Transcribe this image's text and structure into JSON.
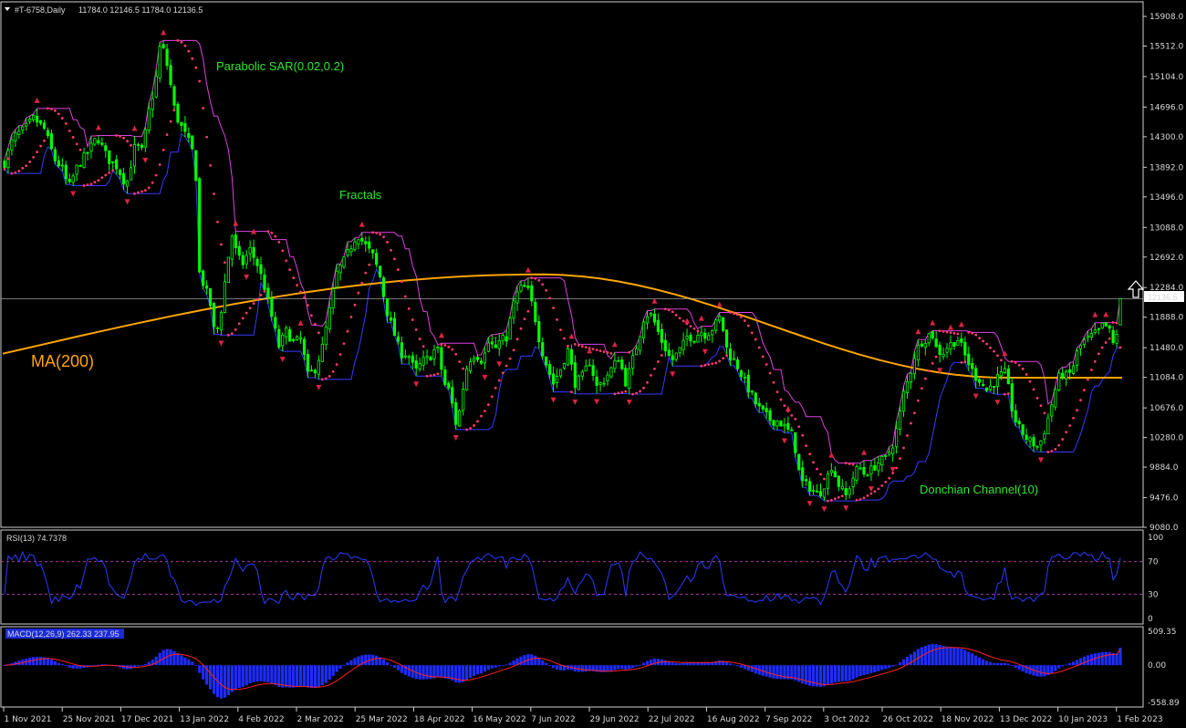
{
  "chart_data": {
    "type": "candlestick",
    "header": {
      "title": "#T-6758,Daily",
      "ohlc": "11784.0 12146.5 11784.0 12136.5"
    },
    "price_axis": {
      "ticks": [
        "15908.0",
        "15512.0",
        "15104.0",
        "14696.0",
        "14300.0",
        "13892.0",
        "13496.0",
        "13088.0",
        "12692.0",
        "12284.0",
        "11888.0",
        "11480.0",
        "11084.0",
        "10676.0",
        "10280.0",
        "9884.0",
        "9476.0",
        "9080.0"
      ],
      "ylim": [
        9080,
        15908
      ],
      "current_price": "12136.5"
    },
    "x_axis": {
      "ticks": [
        "1 Nov 2021",
        "25 Nov 2021",
        "17 Dec 2021",
        "13 Jan 2022",
        "4 Feb 2022",
        "2 Mar 2022",
        "25 Mar 2022",
        "18 Apr 2022",
        "16 May 2022",
        "7 Jun 2022",
        "29 Jun 2022",
        "22 Jul 2022",
        "16 Aug 2022",
        "7 Sep 2022",
        "3 Oct 2022",
        "26 Oct 2022",
        "18 Nov 2022",
        "13 Dec 2022",
        "10 Jan 2023",
        "1 Feb 2023"
      ]
    },
    "close_path": [
      [
        0,
        13950
      ],
      [
        10,
        14300
      ],
      [
        22,
        14400
      ],
      [
        32,
        14550
      ],
      [
        44,
        14400
      ],
      [
        55,
        14000
      ],
      [
        65,
        13850
      ],
      [
        70,
        13600
      ],
      [
        80,
        13900
      ],
      [
        92,
        14100
      ],
      [
        102,
        14300
      ],
      [
        114,
        14000
      ],
      [
        124,
        13900
      ],
      [
        134,
        13650
      ],
      [
        144,
        14200
      ],
      [
        152,
        14100
      ],
      [
        158,
        14600
      ],
      [
        166,
        15000
      ],
      [
        172,
        15600
      ],
      [
        180,
        15200
      ],
      [
        188,
        14600
      ],
      [
        196,
        14400
      ],
      [
        204,
        14200
      ],
      [
        210,
        14000
      ],
      [
        214,
        12500
      ],
      [
        220,
        12300
      ],
      [
        226,
        12100
      ],
      [
        232,
        11600
      ],
      [
        238,
        11950
      ],
      [
        244,
        12500
      ],
      [
        250,
        13000
      ],
      [
        256,
        12700
      ],
      [
        262,
        12600
      ],
      [
        270,
        12800
      ],
      [
        278,
        12600
      ],
      [
        286,
        12300
      ],
      [
        294,
        11900
      ],
      [
        302,
        11500
      ],
      [
        310,
        11700
      ],
      [
        318,
        11550
      ],
      [
        326,
        11600
      ],
      [
        334,
        11100
      ],
      [
        342,
        11200
      ],
      [
        350,
        11500
      ],
      [
        358,
        12000
      ],
      [
        366,
        12500
      ],
      [
        372,
        12600
      ],
      [
        380,
        12800
      ],
      [
        388,
        13000
      ],
      [
        394,
        12900
      ],
      [
        400,
        12800
      ],
      [
        406,
        12700
      ],
      [
        414,
        12400
      ],
      [
        420,
        12000
      ],
      [
        428,
        11700
      ],
      [
        436,
        11400
      ],
      [
        444,
        11400
      ],
      [
        452,
        11150
      ],
      [
        460,
        11300
      ],
      [
        468,
        11350
      ],
      [
        476,
        11500
      ],
      [
        484,
        11000
      ],
      [
        490,
        10900
      ],
      [
        498,
        10400
      ],
      [
        504,
        10900
      ],
      [
        510,
        11300
      ],
      [
        518,
        11400
      ],
      [
        526,
        11300
      ],
      [
        534,
        11600
      ],
      [
        540,
        11400
      ],
      [
        546,
        11700
      ],
      [
        552,
        11500
      ],
      [
        558,
        12000
      ],
      [
        564,
        12200
      ],
      [
        570,
        12300
      ],
      [
        576,
        12250
      ],
      [
        582,
        12000
      ],
      [
        590,
        11500
      ],
      [
        598,
        11200
      ],
      [
        604,
        11000
      ],
      [
        612,
        11200
      ],
      [
        620,
        11450
      ],
      [
        628,
        11000
      ],
      [
        636,
        11100
      ],
      [
        644,
        11300
      ],
      [
        652,
        10950
      ],
      [
        660,
        11050
      ],
      [
        668,
        11200
      ],
      [
        676,
        11350
      ],
      [
        684,
        11000
      ],
      [
        692,
        11350
      ],
      [
        698,
        11600
      ],
      [
        704,
        11900
      ],
      [
        710,
        11950
      ],
      [
        716,
        11800
      ],
      [
        722,
        11600
      ],
      [
        728,
        11450
      ],
      [
        734,
        11300
      ],
      [
        740,
        11400
      ],
      [
        746,
        11500
      ],
      [
        752,
        11650
      ],
      [
        758,
        11600
      ],
      [
        766,
        11700
      ],
      [
        772,
        11650
      ],
      [
        780,
        11750
      ],
      [
        788,
        11900
      ],
      [
        796,
        11400
      ],
      [
        804,
        11300
      ],
      [
        812,
        11100
      ],
      [
        820,
        10900
      ],
      [
        828,
        10700
      ],
      [
        836,
        10600
      ],
      [
        844,
        10500
      ],
      [
        852,
        10500
      ],
      [
        860,
        10400
      ],
      [
        868,
        10300
      ],
      [
        876,
        9700
      ],
      [
        882,
        9650
      ],
      [
        888,
        9600
      ],
      [
        896,
        9500
      ],
      [
        904,
        9700
      ],
      [
        910,
        9900
      ],
      [
        918,
        9650
      ],
      [
        926,
        9500
      ],
      [
        934,
        9750
      ],
      [
        940,
        9900
      ],
      [
        946,
        9800
      ],
      [
        954,
        9850
      ],
      [
        962,
        9950
      ],
      [
        970,
        10000
      ],
      [
        978,
        10200
      ],
      [
        984,
        10500
      ],
      [
        990,
        10900
      ],
      [
        996,
        11100
      ],
      [
        1002,
        11400
      ],
      [
        1008,
        11550
      ],
      [
        1014,
        11600
      ],
      [
        1020,
        11700
      ],
      [
        1026,
        11450
      ],
      [
        1032,
        11400
      ],
      [
        1038,
        11500
      ],
      [
        1044,
        11550
      ],
      [
        1050,
        11600
      ],
      [
        1056,
        11400
      ],
      [
        1062,
        11250
      ],
      [
        1068,
        11100
      ],
      [
        1074,
        11050
      ],
      [
        1080,
        10900
      ],
      [
        1088,
        11000
      ],
      [
        1094,
        11100
      ],
      [
        1102,
        11150
      ],
      [
        1108,
        10700
      ],
      [
        1114,
        10450
      ],
      [
        1120,
        10350
      ],
      [
        1126,
        10250
      ],
      [
        1132,
        10200
      ],
      [
        1138,
        10150
      ],
      [
        1144,
        10350
      ],
      [
        1150,
        10600
      ],
      [
        1156,
        10900
      ],
      [
        1162,
        11150
      ],
      [
        1168,
        11100
      ],
      [
        1174,
        11150
      ],
      [
        1180,
        11400
      ],
      [
        1186,
        11550
      ],
      [
        1192,
        11600
      ],
      [
        1198,
        11650
      ],
      [
        1204,
        11700
      ],
      [
        1210,
        11800
      ],
      [
        1216,
        11700
      ],
      [
        1222,
        11450
      ],
      [
        1228,
        12136
      ]
    ],
    "indicators": {
      "ma200": {
        "label": "MA(200)",
        "color": "#ffa500",
        "y_start": 11400,
        "y_mid": 12460,
        "y_end": 11080
      },
      "parabolic_sar": {
        "label": "Parabolic SAR(0.02,0.2)",
        "color": "#ff3a6a"
      },
      "fractals": {
        "label": "Fractals",
        "color": "#dd2244"
      },
      "donchian": {
        "label": "Donchian Channel(10)",
        "upper_color": "#e040e0",
        "lower_color": "#3a3aff"
      },
      "rsi": {
        "label": "RSI(13) 74.7378",
        "ticks": [
          "100",
          "70",
          "30",
          "0"
        ],
        "levels": [
          70,
          30
        ],
        "ylim": [
          0,
          100
        ],
        "last": 74.7378
      },
      "macd": {
        "label": "MACD(12,26,9) 262.33 237.95",
        "ticks": [
          "509.35",
          "0.00",
          "-558.89"
        ],
        "ylim": [
          -558.89,
          509.35
        ],
        "last": 262.33,
        "signal_last": 237.95
      }
    },
    "candle_color": "#00ff00",
    "grid": false
  }
}
